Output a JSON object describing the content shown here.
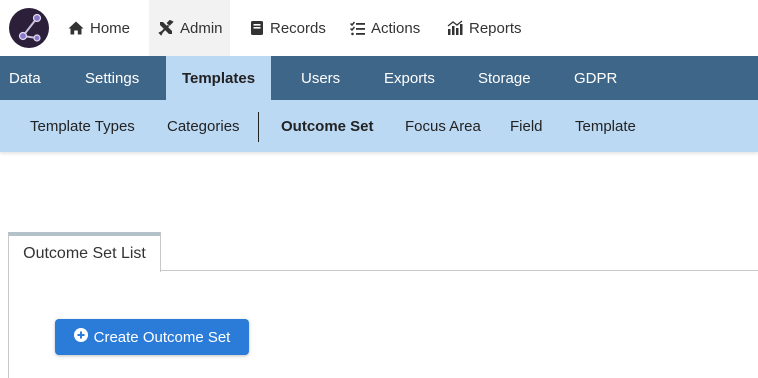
{
  "topnav": {
    "logo_icon": "graph-logo-icon",
    "items": [
      {
        "label": "Home",
        "icon": "home-icon"
      },
      {
        "label": "Admin",
        "icon": "tools-icon"
      },
      {
        "label": "Records",
        "icon": "book-icon"
      },
      {
        "label": "Actions",
        "icon": "checklist-icon"
      },
      {
        "label": "Reports",
        "icon": "chart-icon"
      }
    ],
    "active": "Admin"
  },
  "secnav": {
    "items": [
      "Data",
      "Settings",
      "Templates",
      "Users",
      "Exports",
      "Storage",
      "GDPR"
    ],
    "active": "Templates"
  },
  "subnav": {
    "items": [
      "Template Types",
      "Categories",
      "Outcome Set",
      "Focus Area",
      "Field",
      "Template"
    ],
    "active": "Outcome Set"
  },
  "panel": {
    "tab_label": "Outcome Set List",
    "create_button_label": "Create Outcome Set",
    "create_button_icon": "plus-circle-icon"
  },
  "colors": {
    "section_bar": "#3e6688",
    "sub_bar": "#bcd9f4",
    "primary_button": "#2b7cd8",
    "logo_bg": "#2b1f3a"
  }
}
